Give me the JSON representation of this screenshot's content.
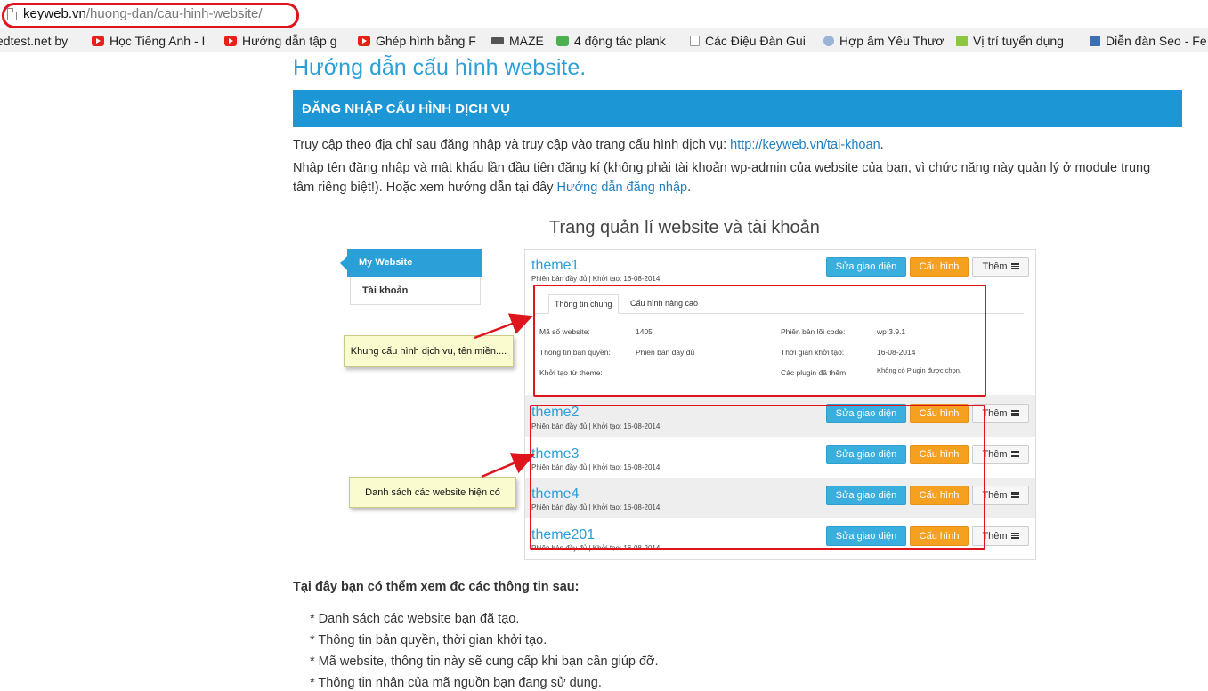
{
  "browser": {
    "url_host": "keyweb.vn",
    "url_path": "/huong-dan/cau-hinh-website/",
    "bookmarks": [
      {
        "label": "edtest.net by",
        "icon": "none"
      },
      {
        "label": "Học Tiếng Anh - I",
        "icon": "youtube-icon"
      },
      {
        "label": "Hướng dẫn tập g",
        "icon": "youtube-icon"
      },
      {
        "label": "Ghép hình bằng F",
        "icon": "youtube-icon"
      },
      {
        "label": "MAZE",
        "icon": "maze-icon"
      },
      {
        "label": "4 động tác plank",
        "icon": "fs-icon"
      },
      {
        "label": "Các Điệu Đàn Gui",
        "icon": "page-icon"
      },
      {
        "label": "Hợp âm Yêu Thươ",
        "icon": "disc-icon"
      },
      {
        "label": "Vị trí tuyển dụng",
        "icon": "square-icon"
      },
      {
        "label": "Diễn đàn Seo - Fe",
        "icon": "stack-icon"
      }
    ]
  },
  "article": {
    "title": "Hướng dẫn cấu hình website.",
    "section_title": "ĐĂNG NHẬP CẤU HÌNH DỊCH VỤ",
    "p1_text": "Truy cập theo địa chỉ sau đăng nhập và truy cập vào trang cấu hình dịch vụ: ",
    "p1_link": "http://keyweb.vn/tai-khoan",
    "p1_end": ".",
    "p2_text": "Nhập tên đăng nhập và mật khẩu lần đầu tiên đăng kí (không phải tài khoản wp-admin của website của bạn, vì chức năng này quản lý ở module trung tâm riêng biệt!). Hoặc xem hướng dẫn tại đây ",
    "p2_link": "Hướng dẫn đăng nhập",
    "p2_end": ".",
    "screenshot_caption": "Trang quản lí website và tài khoản",
    "info_heading": "Tại đây bạn có thểm xem đc các thông tin sau:",
    "bullets": [
      "* Danh sách các website bạn đã tạo.",
      "* Thông tin bản quyền, thời gian khởi tạo.",
      "* Mã website, thông tin này sẽ cung cấp khi bạn cần giúp đỡ.",
      "* Thông tin nhân của mã nguồn bạn đang sử dụng."
    ]
  },
  "screenshot": {
    "sidebar": {
      "my_website": "My Website",
      "account": "Tài khoản"
    },
    "buttons": {
      "edit_theme": "Sửa giao diện",
      "configure": "Cấu hình",
      "more": "Thêm"
    },
    "sites": [
      {
        "name": "theme1",
        "meta": "Phiên bản đầy đủ | Khởi tạo: 16-08-2014"
      },
      {
        "name": "theme2",
        "meta": "Phiên bản đầy đủ | Khởi tạo: 16-08-2014"
      },
      {
        "name": "theme3",
        "meta": "Phiên bản đầy đủ | Khởi tạo: 16-08-2014"
      },
      {
        "name": "theme4",
        "meta": "Phiên bản đầy đủ | Khởi tạo: 16-08-2014"
      },
      {
        "name": "theme201",
        "meta": "Phiên bản đầy đủ | Khởi tạo: 16-08-2014"
      }
    ],
    "detail": {
      "tab_general": "Thông tin chung",
      "tab_advanced": "Cấu hình nâng cao",
      "website_code_label": "Mã số website:",
      "website_code_value": "1405",
      "license_label": "Thông tin bản quyền:",
      "license_value": "Phiên bản đầy đủ",
      "init_theme_label": "Khởi tạo từ theme:",
      "core_version_label": "Phiên bản lõi code:",
      "core_version_value": "wp 3.9.1",
      "init_time_label": "Thời gian khởi tạo:",
      "init_time_value": "16-08-2014",
      "plugins_label": "Các plugin đã thêm:",
      "plugins_value": "Không có Plugin được chọn."
    },
    "notes": {
      "service_frame": "Khung cấu hình dịch vụ, tên miền....",
      "website_list": "Danh sách các website hiện có"
    }
  },
  "colors": {
    "accent": "#1c96d4",
    "link": "#1f7fc1",
    "highlight": "#e0141c",
    "orange_button": "#f6a020",
    "blue_button": "#3aaede"
  }
}
